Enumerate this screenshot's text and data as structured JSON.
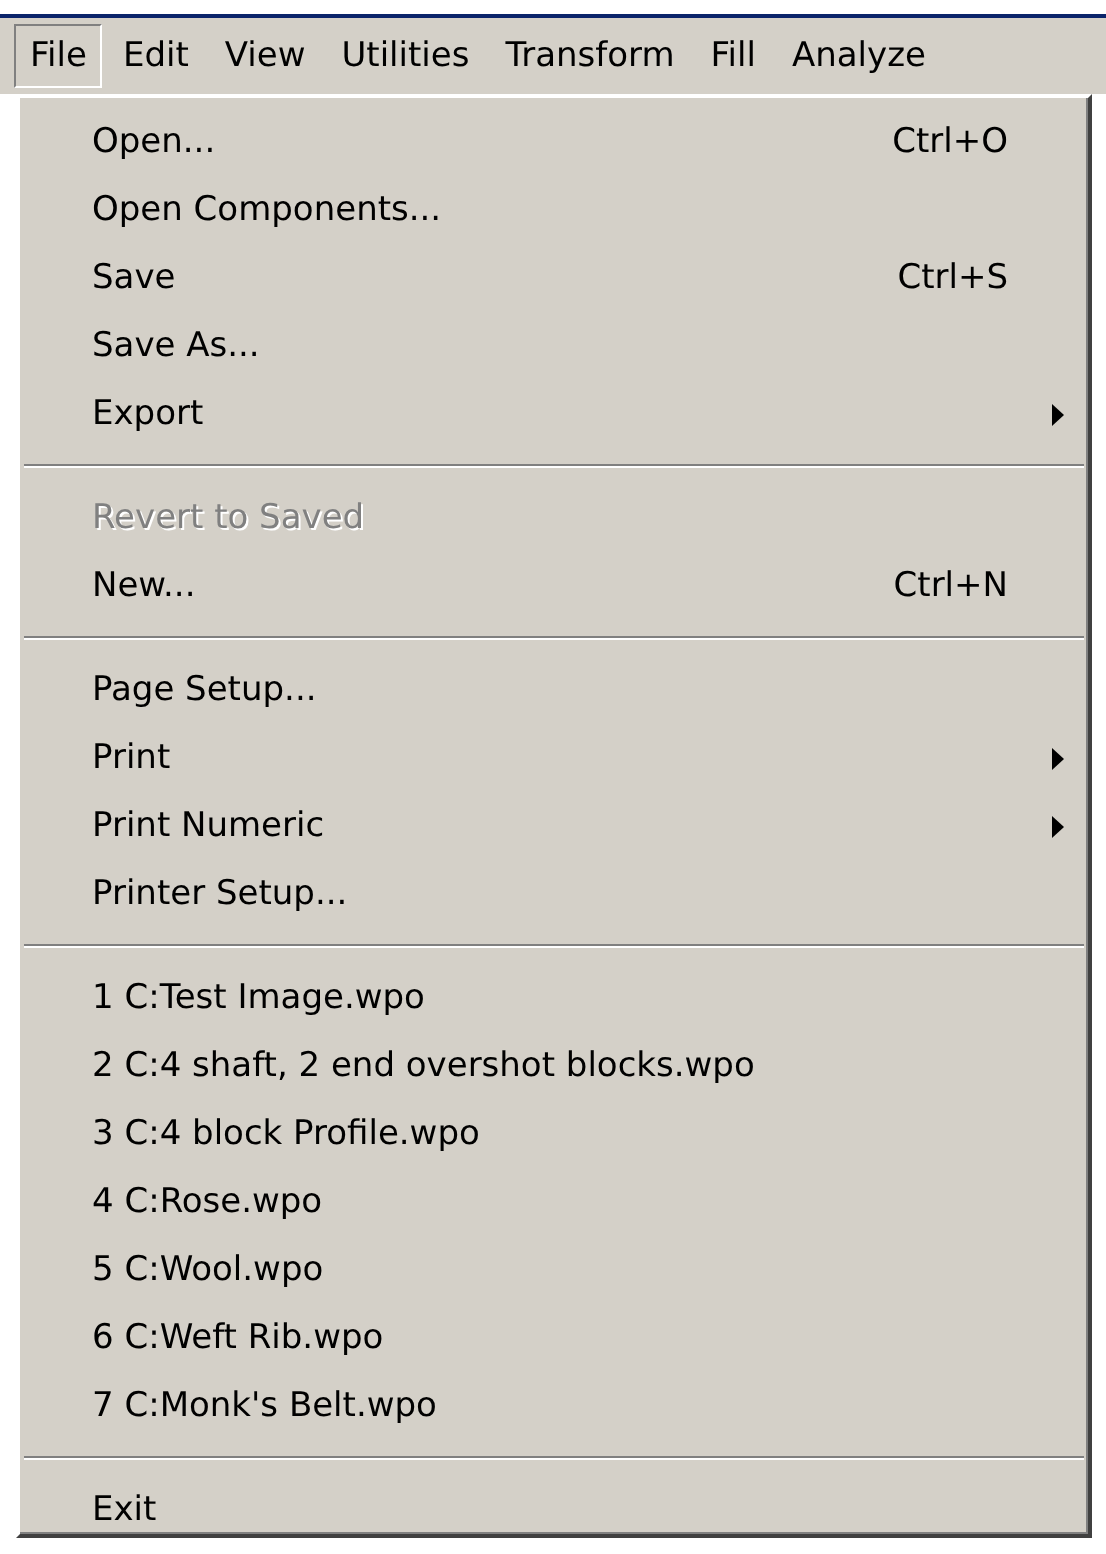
{
  "menubar": [
    {
      "label": "File",
      "selected": true
    },
    {
      "label": "Edit",
      "selected": false
    },
    {
      "label": "View",
      "selected": false
    },
    {
      "label": "Utilities",
      "selected": false
    },
    {
      "label": "Transform",
      "selected": false
    },
    {
      "label": "Fill",
      "selected": false
    },
    {
      "label": "Analyze",
      "selected": false
    }
  ],
  "menu": {
    "sections": [
      {
        "items": [
          {
            "label": "Open...",
            "shortcut": "Ctrl+O",
            "kind": "command",
            "disabled": false
          },
          {
            "label": "Open Components...",
            "kind": "command",
            "disabled": false
          },
          {
            "label": "Save",
            "shortcut": "Ctrl+S",
            "kind": "command",
            "disabled": false
          },
          {
            "label": "Save As...",
            "kind": "command",
            "disabled": false
          },
          {
            "label": "Export",
            "kind": "submenu",
            "disabled": false
          }
        ]
      },
      {
        "items": [
          {
            "label": "Revert to Saved",
            "kind": "command",
            "disabled": true
          },
          {
            "label": "New...",
            "shortcut": "Ctrl+N",
            "kind": "command",
            "disabled": false
          }
        ]
      },
      {
        "items": [
          {
            "label": "Page Setup...",
            "kind": "command",
            "disabled": false
          },
          {
            "label": "Print",
            "kind": "submenu",
            "disabled": false
          },
          {
            "label": "Print Numeric",
            "kind": "submenu",
            "disabled": false
          },
          {
            "label": "Printer Setup...",
            "kind": "command",
            "disabled": false
          }
        ]
      },
      {
        "items": [
          {
            "label": "1 C:Test Image.wpo",
            "kind": "command",
            "disabled": false
          },
          {
            "label": "2 C:4 shaft, 2 end overshot blocks.wpo",
            "kind": "command",
            "disabled": false
          },
          {
            "label": "3 C:4 block Profile.wpo",
            "kind": "command",
            "disabled": false
          },
          {
            "label": "4 C:Rose.wpo",
            "kind": "command",
            "disabled": false
          },
          {
            "label": "5 C:Wool.wpo",
            "kind": "command",
            "disabled": false
          },
          {
            "label": "6 C:Weft Rib.wpo",
            "kind": "command",
            "disabled": false
          },
          {
            "label": "7 C:Monk's Belt.wpo",
            "kind": "command",
            "disabled": false
          }
        ]
      },
      {
        "items": [
          {
            "label": "Exit",
            "kind": "command",
            "disabled": false
          }
        ]
      }
    ]
  }
}
